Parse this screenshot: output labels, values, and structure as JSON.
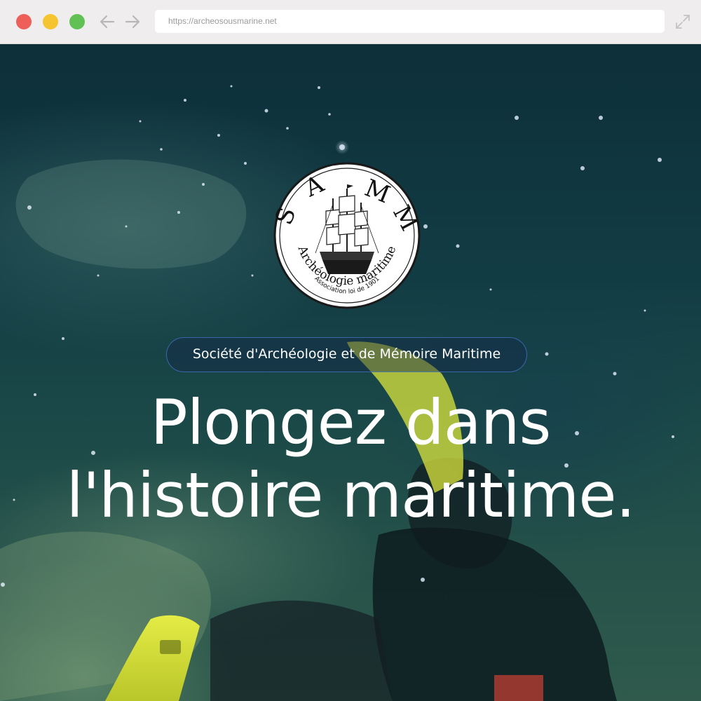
{
  "browser": {
    "url": "https://archeosousmarine.net",
    "traffic_lights": [
      "#ee5f5a",
      "#f5c42f",
      "#62c155"
    ],
    "icons": [
      "back-arrow-icon",
      "forward-arrow-icon",
      "expand-icon"
    ]
  },
  "logo": {
    "letters": [
      "S",
      "A",
      "M",
      "M"
    ],
    "arc_text": "Archéologie maritime",
    "sub_text": "Association loi de 1901",
    "image": "sailing-ship"
  },
  "hero": {
    "tagline": "Société d'Archéologie et de Mémoire Maritime",
    "title_line1": "Plongez dans",
    "title_line2": "l'histoire maritime."
  },
  "colors": {
    "pill_border": "#4678c8",
    "fin_yellow": "#d8e23a",
    "water_top": "#0d2f3a",
    "water_bottom": "#2f5a4c"
  }
}
